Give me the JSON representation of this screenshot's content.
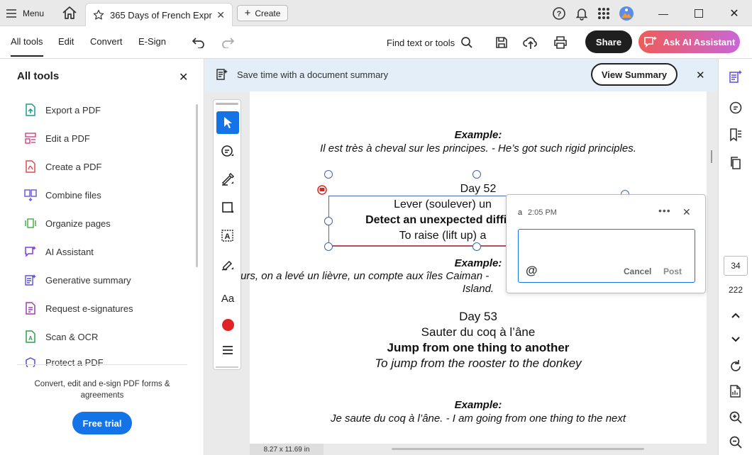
{
  "titlebar": {
    "menu_label": "Menu",
    "tab_title": "365 Days of French Expr...",
    "create_label": "Create"
  },
  "toolbar": {
    "menu_items": [
      "All tools",
      "Edit",
      "Convert",
      "E-Sign"
    ],
    "find_label": "Find text or tools",
    "share_label": "Share",
    "ai_label": "Ask AI Assistant"
  },
  "left_panel": {
    "title": "All tools",
    "items": [
      {
        "label": "Export a PDF",
        "icon": "export-pdf-icon",
        "color": "#1a9c8c"
      },
      {
        "label": "Edit a PDF",
        "icon": "edit-pdf-icon",
        "color": "#d94b8a"
      },
      {
        "label": "Create a PDF",
        "icon": "create-pdf-icon",
        "color": "#e34850"
      },
      {
        "label": "Combine files",
        "icon": "combine-files-icon",
        "color": "#6b5ce7"
      },
      {
        "label": "Organize pages",
        "icon": "organize-pages-icon",
        "color": "#4caf50"
      },
      {
        "label": "AI Assistant",
        "icon": "ai-assistant-icon",
        "color": "#7b3fe4"
      },
      {
        "label": "Generative summary",
        "icon": "generative-summary-icon",
        "color": "#5a4fe0"
      },
      {
        "label": "Request e-signatures",
        "icon": "request-esignature-icon",
        "color": "#9b3fb5"
      },
      {
        "label": "Scan & OCR",
        "icon": "scan-ocr-icon",
        "color": "#2e9e4f"
      },
      {
        "label": "Protect a PDF",
        "icon": "protect-pdf-icon",
        "color": "#5a4fe0"
      }
    ],
    "promo_text": "Convert, edit and e-sign PDF forms & agreements",
    "trial_label": "Free trial"
  },
  "banner": {
    "text": "Save time with a document summary",
    "button_label": "View Summary"
  },
  "document": {
    "ex1_label": "Example:",
    "ex1_text": "Il est très à cheval sur les principes. - He’s got such rigid principles.",
    "day52_title": "Day 52",
    "day52_fr": "Lever (soulever) un",
    "day52_en": "Detect an unexpected difficu",
    "day52_lit": "To raise (lift up) a",
    "ex2_label": "Example:",
    "ex2_text": "ours, on a levé un lièvre, un compte aux îles Caiman -",
    "ex2_text2": "Island.",
    "day53_title": "Day 53",
    "day53_fr": "Sauter du coq à l’âne",
    "day53_en": "Jump from one thing to another",
    "day53_lit": "To jump from the rooster to the donkey",
    "ex3_label": "Example:",
    "ex3_text": "Je saute du coq à l’âne. - I am going from one thing to the next",
    "page_size": "8.27 x 11.69 in"
  },
  "tools": {
    "text_tool_label": "Aa",
    "active_color": "#e02424"
  },
  "comment": {
    "user": "a",
    "time": "2:05 PM",
    "cancel_label": "Cancel",
    "post_label": "Post",
    "mention_symbol": "@"
  },
  "right_rail": {
    "current_page": "34",
    "total_pages": "222"
  }
}
